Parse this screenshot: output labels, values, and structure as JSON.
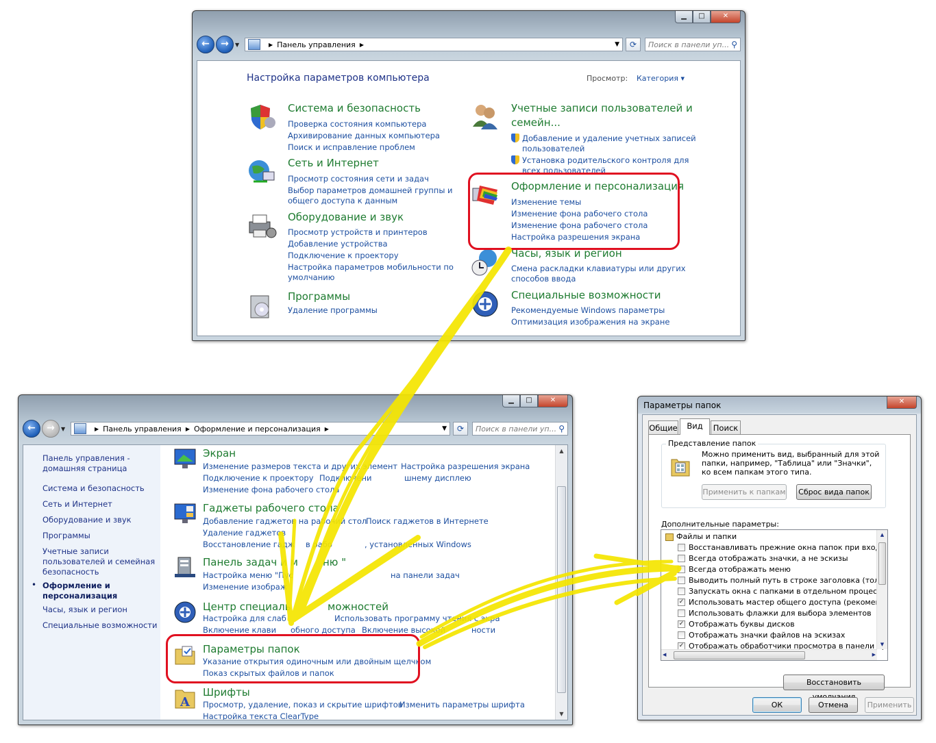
{
  "win1": {
    "breadcrumb": [
      "Панель управления"
    ],
    "search_placeholder": "Поиск в панели уп...",
    "heading": "Настройка параметров компьютера",
    "view_label": "Просмотр:",
    "view_value": "Категория",
    "categories": [
      {
        "title": "Система и безопасность",
        "links": [
          "Проверка состояния компьютера",
          "Архивирование данных компьютера",
          "Поиск и исправление проблем"
        ],
        "icon": "shield-icon"
      },
      {
        "title": "Сеть и Интернет",
        "links": [
          "Просмотр состояния сети и задач",
          "Выбор параметров домашней группы и",
          "общего доступа к данным"
        ],
        "icon": "network-globe-icon"
      },
      {
        "title": "Оборудование и звук",
        "links": [
          "Просмотр устройств и принтеров",
          "Добавление устройства",
          "Подключение к проектору",
          "Настройка параметров мобильности по",
          "умолчанию"
        ],
        "icon": "printer-icon"
      },
      {
        "title": "Программы",
        "links": [
          "Удаление программы"
        ],
        "icon": "programs-box-icon"
      },
      {
        "title": "Учетные записи пользователей и",
        "title2": "семейн...",
        "links": [
          "Добавление и удаление учетных записей",
          "пользователей",
          "Установка родительского контроля для",
          "всех пользователей"
        ],
        "icon": "users-icon"
      },
      {
        "title": "Оформление и персонализация",
        "links": [
          "Изменение темы",
          "Изменение фона рабочего стола",
          "Изменение фона рабочего стола",
          "Настройка разрешения экрана"
        ],
        "icon": "personalization-palette-icon"
      },
      {
        "title": "Часы, язык и регион",
        "links": [
          "Смена раскладки клавиатуры или других",
          "способов ввода"
        ],
        "icon": "clock-globe-icon"
      },
      {
        "title": "Специальные возможности",
        "links": [
          "Рекомендуемые Windows параметры",
          "Оптимизация изображения на экране"
        ],
        "icon": "accessibility-icon"
      }
    ]
  },
  "win2": {
    "breadcrumb": [
      "Панель управления",
      "Оформление и персонализация"
    ],
    "search_placeholder": "Поиск в панели уп...",
    "nav": [
      "Панель управления -",
      "домашняя страница",
      "Система и безопасность",
      "Сеть и Интернет",
      "Оборудование и звук",
      "Программы",
      "Учетные записи",
      "пользователей и семейная",
      "безопасность",
      "Оформление и",
      "персонализация",
      "Часы, язык и регион",
      "Специальные возможности"
    ],
    "items": [
      {
        "title": "Экран",
        "links": [
          "Изменение размеров текста и других элемент",
          "Настройка разрешения экрана",
          "Подключение к проектору",
          "Подключени",
          "шнему дисплею",
          "Изменение фона рабочего стола"
        ],
        "icon": "monitor-icon"
      },
      {
        "title": "Гаджеты рабочего стола",
        "links": [
          "Добавление гаджетов на рабочий стол",
          "Поиск гаджетов в Интернете",
          "Удаление гаджетов",
          "Восстановление гадж",
          "в рабо",
          ", установленных Windows"
        ],
        "icon": "gadgets-icon"
      },
      {
        "title": "Панель задач и м",
        "title_b": "ню \"",
        "links": [
          "Настройка меню \"Пус",
          "на панели задач",
          "Изменение изображ"
        ],
        "icon": "taskbar-icon"
      },
      {
        "title": "Центр специаль",
        "title_b": "можностей",
        "links": [
          "Настройка для слаб",
          "Использовать программу чтения с экра",
          "Включение клави",
          "обного доступа",
          "Включение высокой",
          "ности"
        ],
        "icon": "ease-of-access-icon"
      },
      {
        "title": "Параметры папок",
        "links": [
          "Указание открытия одиночным или двойным щелчком",
          "Показ скрытых файлов и папок"
        ],
        "icon": "folder-options-icon"
      },
      {
        "title": "Шрифты",
        "links": [
          "Просмотр, удаление, показ и скрытие шрифтов",
          "Изменить параметры шрифта",
          "Настройка текста ClearType"
        ],
        "icon": "fonts-icon"
      }
    ]
  },
  "dialog": {
    "title": "Параметры папок",
    "tabs": [
      "Общие",
      "Вид",
      "Поиск"
    ],
    "group_title": "Представление папок",
    "group_text": [
      "Можно применить вид, выбранный для этой",
      "папки, например, \"Таблица\" или \"Значки\",",
      "ко всем папкам этого типа."
    ],
    "apply_btn": "Применить к папкам",
    "reset_btn": "Сброс вида папок",
    "advanced_label": "Дополнительные параметры:",
    "tree_root": "Файлы и папки",
    "options": [
      {
        "label": "Восстанавливать прежние окна папок при входе в си",
        "checked": false
      },
      {
        "label": "Всегда отображать значки, а не эскизы",
        "checked": false
      },
      {
        "label": "Всегда отображать меню",
        "checked": false
      },
      {
        "label": "Выводить полный путь в строке заголовка (только д",
        "checked": false
      },
      {
        "label": "Запускать окна с папками в отдельном процессе",
        "checked": false
      },
      {
        "label": "Использовать мастер общего доступа (рекомендует",
        "checked": true
      },
      {
        "label": "Использовать флажки для выбора элементов",
        "checked": false
      },
      {
        "label": "Отображать буквы дисков",
        "checked": true
      },
      {
        "label": "Отображать значки файлов на эскизах",
        "checked": false
      },
      {
        "label": "Отображать обработчики просмотра в панели просм",
        "checked": true
      }
    ],
    "restore_btn": "Восстановить умолчания",
    "ok": "ОК",
    "cancel": "Отмена",
    "apply": "Применить"
  },
  "colors": {
    "highlight": "#e01020",
    "arrow": "#f5e600",
    "title_green": "#1e7b30",
    "link_blue": "#1d4fa0"
  }
}
